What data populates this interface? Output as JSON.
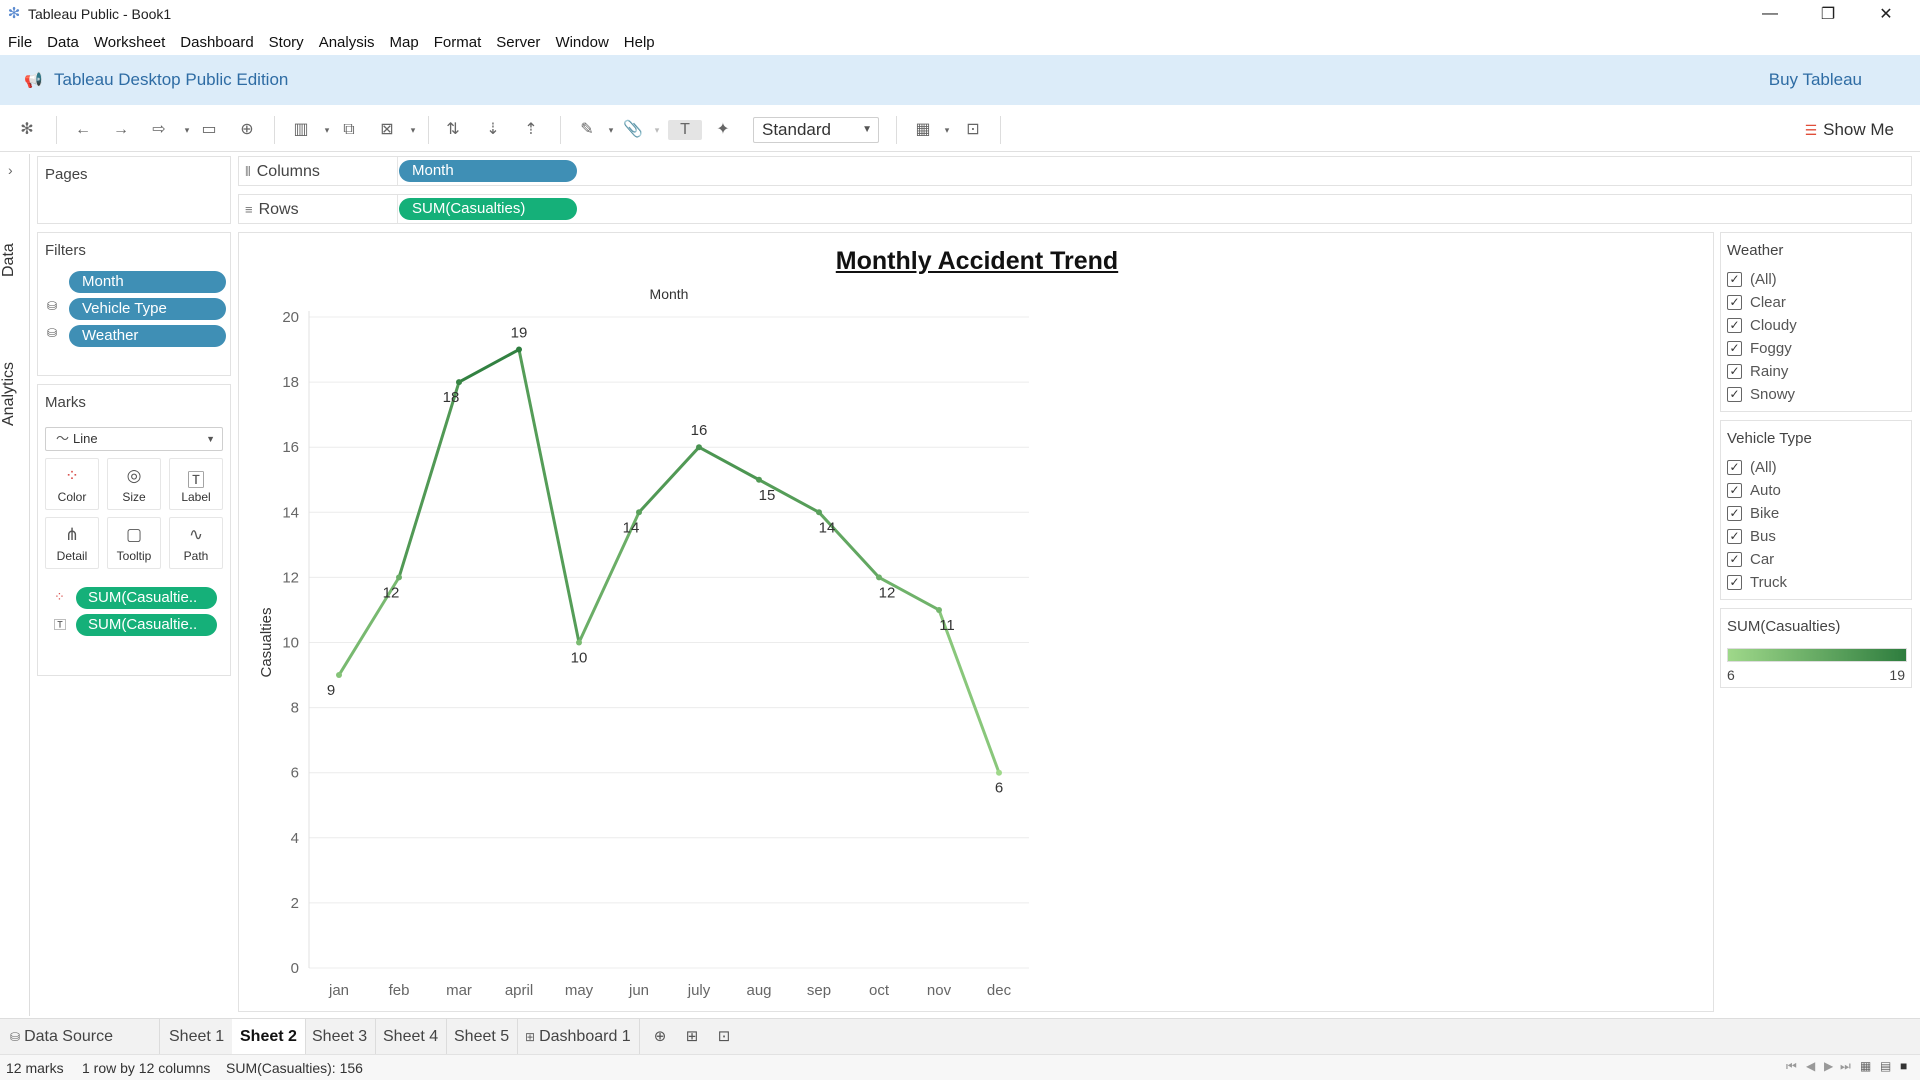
{
  "window": {
    "title": "Tableau Public - Book1"
  },
  "menu": [
    "File",
    "Data",
    "Worksheet",
    "Dashboard",
    "Story",
    "Analysis",
    "Map",
    "Format",
    "Server",
    "Window",
    "Help"
  ],
  "banner": {
    "edition": "Tableau Desktop Public Edition",
    "buy": "Buy Tableau"
  },
  "toolbar": {
    "fit": "Standard",
    "show_me": "Show Me"
  },
  "rail": {
    "data": "Data",
    "analytics": "Analytics"
  },
  "pages": {
    "title": "Pages"
  },
  "filters": {
    "title": "Filters",
    "items": [
      "Month",
      "Vehicle Type",
      "Weather"
    ]
  },
  "marks": {
    "title": "Marks",
    "type": "Line",
    "buttons": [
      "Color",
      "Size",
      "Label",
      "Detail",
      "Tooltip",
      "Path"
    ],
    "fields": [
      "SUM(Casualtie..",
      "SUM(Casualtie.."
    ]
  },
  "shelves": {
    "columns_label": "Columns",
    "columns_pill": "Month",
    "rows_label": "Rows",
    "rows_pill": "SUM(Casualties)"
  },
  "chart_data": {
    "type": "line",
    "title": "Monthly Accident Trend",
    "xlabel": "Month",
    "ylabel": "Casualties",
    "categories": [
      "jan",
      "feb",
      "mar",
      "april",
      "may",
      "jun",
      "july",
      "aug",
      "sep",
      "oct",
      "nov",
      "dec"
    ],
    "values": [
      9,
      12,
      18,
      19,
      10,
      14,
      16,
      15,
      14,
      12,
      11,
      6
    ],
    "ylim": [
      0,
      20
    ],
    "yticks": [
      0,
      2,
      4,
      6,
      8,
      10,
      12,
      14,
      16,
      18,
      20
    ],
    "grid": true,
    "color_scale": {
      "min": 6,
      "max": 19,
      "low_color": "#9fd88a",
      "high_color": "#2e7d3e"
    }
  },
  "legends": {
    "weather": {
      "title": "Weather",
      "items": [
        "(All)",
        "Clear",
        "Cloudy",
        "Foggy",
        "Rainy",
        "Snowy"
      ]
    },
    "vehicle": {
      "title": "Vehicle Type",
      "items": [
        "(All)",
        "Auto",
        "Bike",
        "Bus",
        "Car",
        "Truck"
      ]
    },
    "color": {
      "title": "SUM(Casualties)",
      "min_label": "6",
      "max_label": "19"
    }
  },
  "tabs": {
    "data_source": "Data Source",
    "sheets": [
      "Sheet 1",
      "Sheet 2",
      "Sheet 3",
      "Sheet 4",
      "Sheet 5",
      "Dashboard 1"
    ],
    "active": "Sheet 2"
  },
  "status": {
    "marks": "12 marks",
    "dims": "1 row by 12 columns",
    "sum": "SUM(Casualties): 156"
  }
}
